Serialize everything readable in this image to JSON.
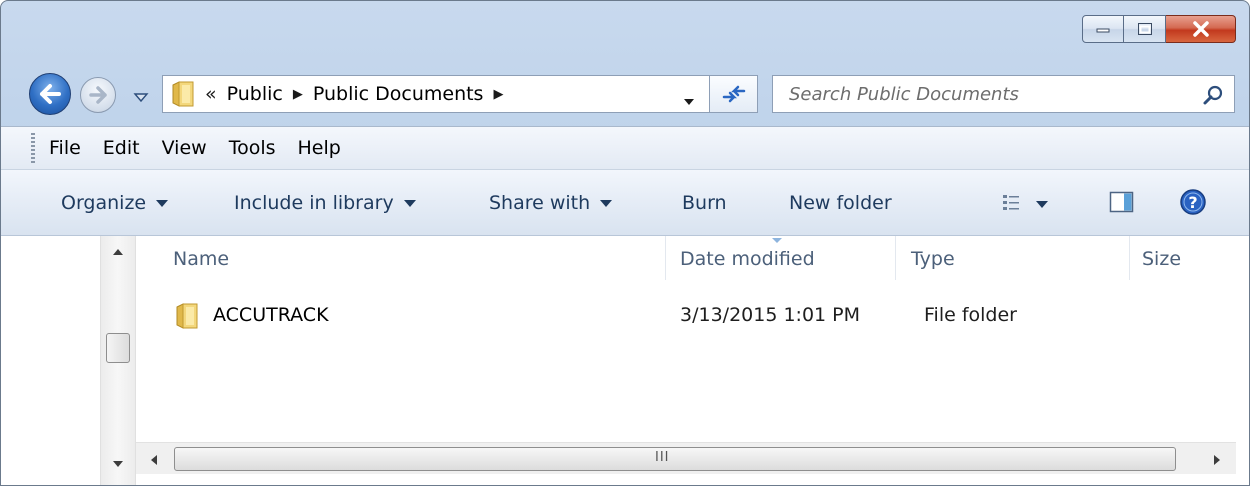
{
  "window": {
    "caption_buttons": [
      "minimize",
      "maximize",
      "close"
    ]
  },
  "address_bar": {
    "overflow": "«",
    "crumbs": [
      "Public",
      "Public Documents"
    ],
    "separator": "▶"
  },
  "search": {
    "placeholder": "Search Public Documents"
  },
  "menu": {
    "items": [
      "File",
      "Edit",
      "View",
      "Tools",
      "Help"
    ]
  },
  "commands": {
    "organize": "Organize",
    "include_in_library": "Include in library",
    "share_with": "Share with",
    "burn": "Burn",
    "new_folder": "New folder"
  },
  "columns": {
    "name": "Name",
    "date_modified": "Date modified",
    "type": "Type",
    "size": "Size"
  },
  "files": [
    {
      "name": "ACCUTRACK",
      "date_modified": "3/13/2015 1:01 PM",
      "type": "File folder",
      "size": "",
      "icon": "folder-icon"
    }
  ],
  "hscroll": {
    "grip": "III"
  },
  "colors": {
    "accent": "#2f6fc4",
    "close": "#c2391e",
    "command_text": "#1e3a5e",
    "header_text": "#4c607a"
  }
}
